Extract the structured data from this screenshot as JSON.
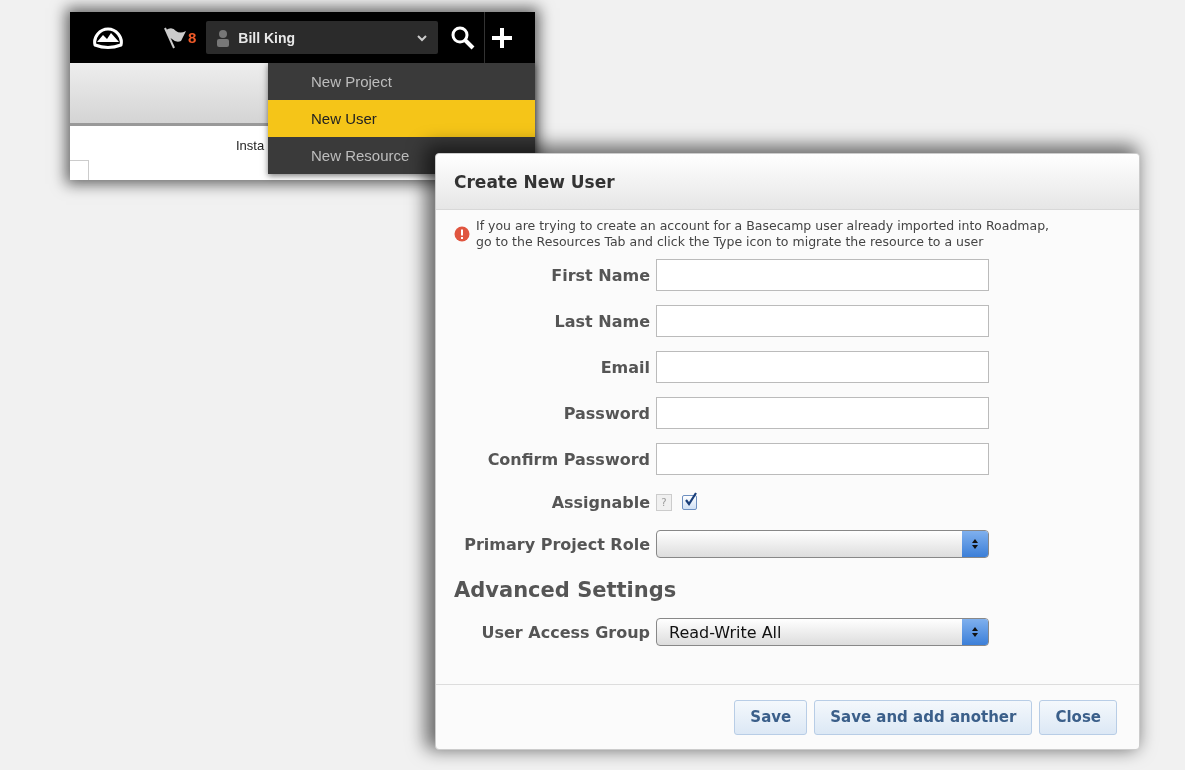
{
  "app_window": {
    "notification_count": "8",
    "user_menu": {
      "name": "Bill King"
    },
    "content_text": "Insta"
  },
  "new_menu": {
    "items": [
      {
        "label": "New Project",
        "selected": false
      },
      {
        "label": "New User",
        "selected": true
      },
      {
        "label": "New Resource",
        "selected": false
      }
    ]
  },
  "dialog": {
    "title": "Create New User",
    "notice": "If you are trying to create an account for a Basecamp user already imported into Roadmap, go to the Resources Tab and click the Type icon to migrate the resource to a user",
    "fields": [
      {
        "kind": "text",
        "label": "First Name"
      },
      {
        "kind": "text",
        "label": "Last Name"
      },
      {
        "kind": "text",
        "label": "Email"
      },
      {
        "kind": "password",
        "label": "Password"
      },
      {
        "kind": "password",
        "label": "Confirm Password"
      },
      {
        "kind": "checkbox",
        "label": "Assignable",
        "help": "?",
        "checked": true
      },
      {
        "kind": "select",
        "label": "Primary Project Role"
      }
    ],
    "section_title": "Advanced Settings",
    "advanced_fields": [
      {
        "kind": "select",
        "label": "User Access Group",
        "value": "Read-Write All"
      }
    ],
    "buttons": [
      "Save",
      "Save and add another",
      "Close"
    ]
  }
}
